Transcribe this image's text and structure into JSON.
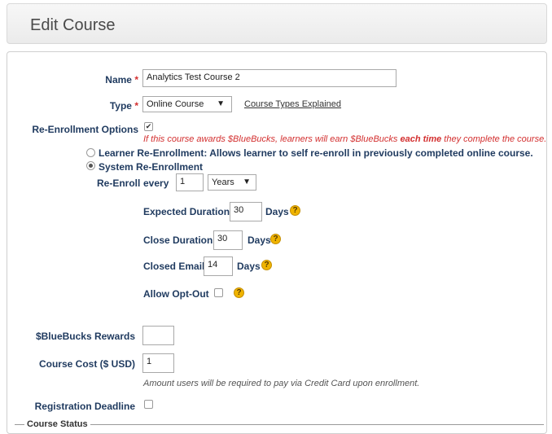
{
  "header": {
    "title": "Edit Course"
  },
  "form": {
    "name_label": "Name",
    "name_value": "Analytics Test Course 2",
    "type_label": "Type",
    "type_value": "Online Course",
    "type_arrow": "▼",
    "type_link": "Course Types Explained",
    "required_mark": "*",
    "reenroll_options_label": "Re-Enrollment Options",
    "reenroll_options_checked": "✔",
    "bluebucks_note_pre": "If this course awards $BlueBucks, learners will earn $BlueBucks ",
    "bluebucks_note_bold": "each time",
    "bluebucks_note_post": " they complete the course.",
    "learner_reenroll_label": "Learner Re-Enrollment: Allows learner to self re-enroll in previously completed online course.",
    "system_reenroll_label": "System Re-Enrollment",
    "reenroll_label": "Re-Enroll",
    "every_label": "every",
    "every_value": "1",
    "period_value": "Years",
    "period_arrow": "▼",
    "expected_duration_label": "Expected Duration",
    "expected_duration_value": "30",
    "close_duration_label": "Close Duration",
    "close_duration_value": "30",
    "closed_email_label": "Closed Email",
    "closed_email_value": "14",
    "days_label": "Days",
    "allow_optout_label": "Allow Opt-Out",
    "help_glyph": "?",
    "bluebucks_rewards_label": "$BlueBucks Rewards",
    "bluebucks_rewards_value": "",
    "course_cost_label": "Course Cost ($ USD)",
    "course_cost_value": "1",
    "course_cost_note": "Amount users will be required to pay via Credit Card upon enrollment.",
    "registration_deadline_label": "Registration Deadline",
    "course_status_legend": "Course Status"
  }
}
